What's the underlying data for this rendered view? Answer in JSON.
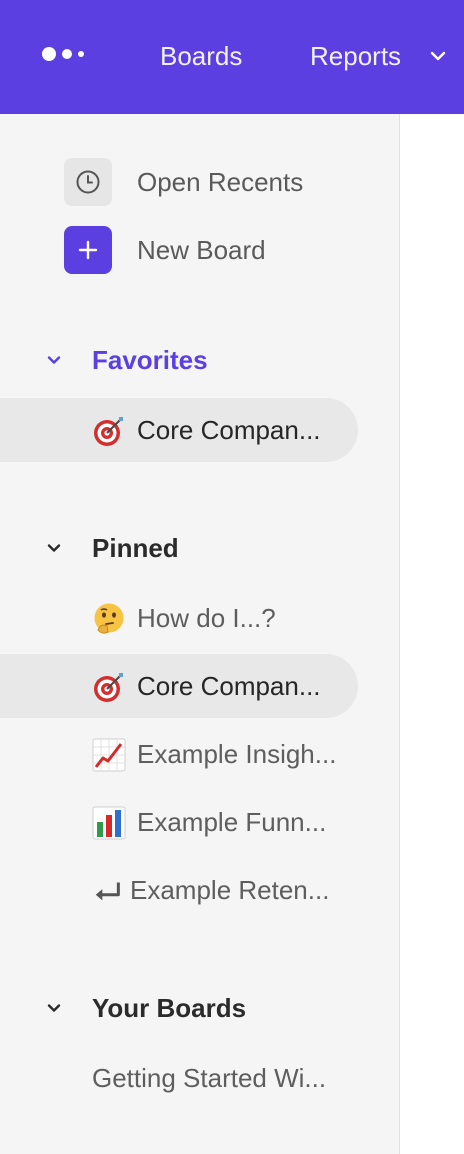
{
  "topbar": {
    "background": "#5B3FE0",
    "logo_icon": "dots-logo-icon",
    "nav": [
      {
        "label": "Boards"
      },
      {
        "label": "Reports",
        "icon": "chevron-down-icon"
      }
    ]
  },
  "sidebar": {
    "actions": [
      {
        "label": "Open Recents",
        "icon": "clock-icon"
      },
      {
        "label": "New Board",
        "icon": "plus-icon"
      }
    ],
    "sections": [
      {
        "title": "Favorites",
        "expanded": true,
        "active": true,
        "items": [
          {
            "icon": "target-dart-icon",
            "label": "Core Compan...",
            "selected": true
          }
        ]
      },
      {
        "title": "Pinned",
        "expanded": true,
        "items": [
          {
            "icon": "thinking-face-icon",
            "label": "How do I...?"
          },
          {
            "icon": "target-dart-icon",
            "label": "Core Compan...",
            "selected": true
          },
          {
            "icon": "chart-increasing-icon",
            "label": "Example Insigh..."
          },
          {
            "icon": "bar-chart-icon",
            "label": "Example Funn..."
          },
          {
            "icon": "return-arrow-icon",
            "label": "Example Reten..."
          }
        ]
      },
      {
        "title": "Your Boards",
        "expanded": true,
        "items": [
          {
            "label": "Getting Started Wi..."
          }
        ]
      }
    ]
  },
  "colors": {
    "accent": "#5B3FE0",
    "sidebar_bg": "#f5f5f5",
    "selected_bg": "#e8e8e8"
  }
}
